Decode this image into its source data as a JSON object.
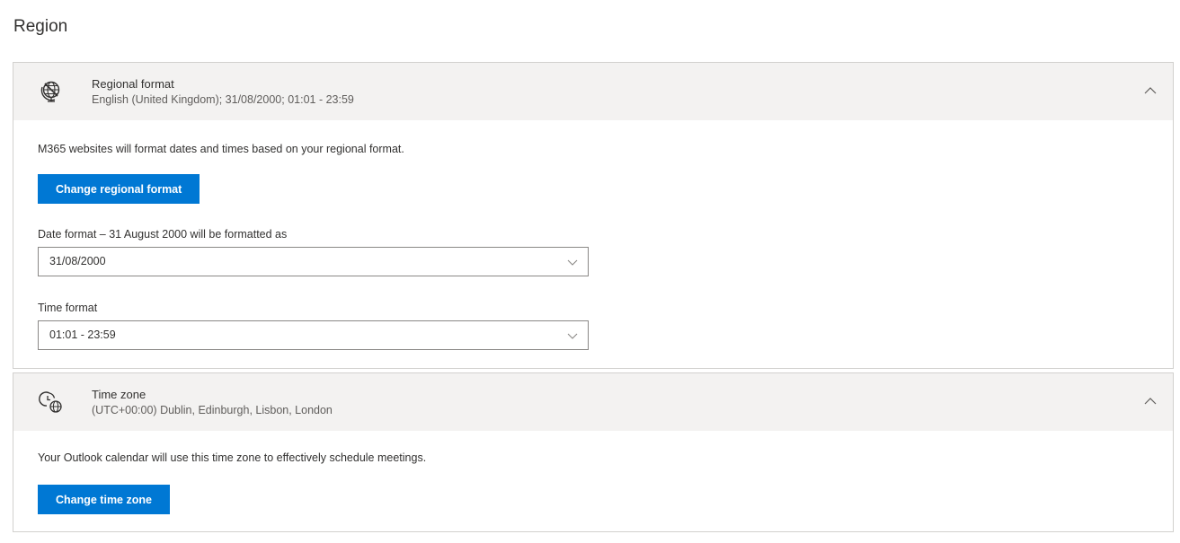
{
  "page": {
    "title": "Region"
  },
  "regional_format": {
    "icon": "globe-crossed-icon",
    "title": "Regional format",
    "summary": "English (United Kingdom); 31/08/2000; 01:01 - 23:59",
    "expanded": true,
    "description": "M365 websites will format dates and times based on your regional format.",
    "change_button_label": "Change regional format",
    "date_format": {
      "label": "Date format – 31 August 2000 will be formatted as",
      "selected": "31/08/2000"
    },
    "time_format": {
      "label": "Time format",
      "selected": "01:01 - 23:59"
    }
  },
  "time_zone": {
    "icon": "clock-globe-icon",
    "title": "Time zone",
    "summary": "(UTC+00:00) Dublin, Edinburgh, Lisbon, London",
    "expanded": true,
    "description": "Your Outlook calendar will use this time zone to effectively schedule meetings.",
    "change_button_label": "Change time zone"
  },
  "colors": {
    "accent": "#0078d4",
    "header_bg": "#f3f2f1",
    "border": "#d2d0ce"
  }
}
